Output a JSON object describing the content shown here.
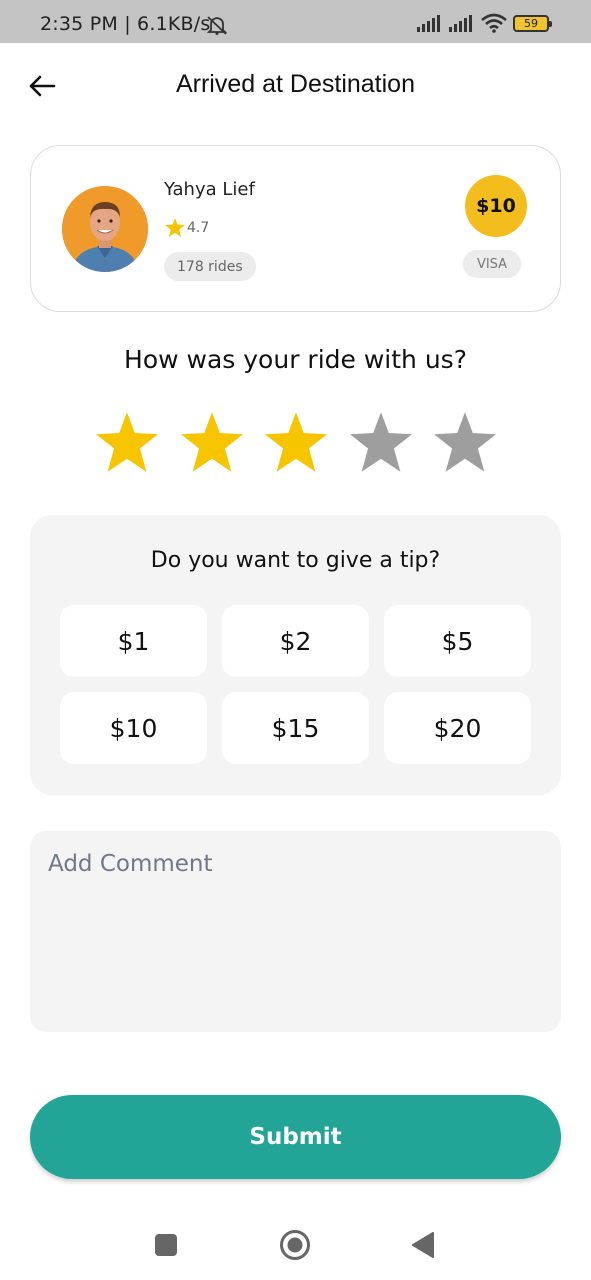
{
  "status_bar": {
    "time": "2:35 PM | 6.1KB/s",
    "battery_level": "59",
    "icons": [
      "mute-icon",
      "signal-icon",
      "signal-icon",
      "wifi-icon",
      "battery-icon"
    ]
  },
  "header": {
    "title": "Arrived at Destination",
    "back_icon": "arrow-left-icon"
  },
  "driver": {
    "name": "Yahya Lief",
    "rating": "4.7",
    "rides": "178 rides",
    "fare": "$10",
    "payment_method": "VISA"
  },
  "feedback": {
    "question": "How was your ride with us?",
    "stars_total": 5,
    "stars_selected": 3,
    "star_active_color": "#f7c500",
    "star_inactive_color": "#9e9e9e"
  },
  "tip": {
    "question": "Do you want to give a tip?",
    "options": [
      "$1",
      "$2",
      "$5",
      "$10",
      "$15",
      "$20"
    ]
  },
  "comment": {
    "placeholder": "Add Comment",
    "value": ""
  },
  "submit": {
    "label": "Submit",
    "color": "#22a596"
  },
  "nav": {
    "icons": [
      "square-icon",
      "circle-home-icon",
      "triangle-back-icon"
    ]
  }
}
